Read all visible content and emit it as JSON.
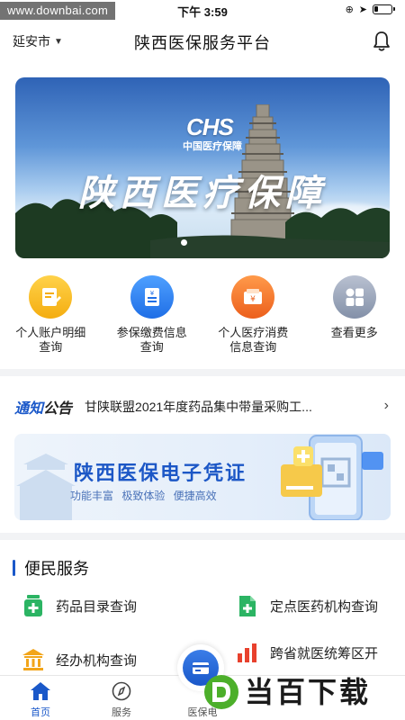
{
  "watermark_top": "www.downbai.com",
  "status_bar": {
    "time": "下午 3:59"
  },
  "header": {
    "city": "延安市",
    "title": "陕西医保服务平台"
  },
  "banner": {
    "logo_text": "CHS",
    "logo_sub": "中国医疗保障",
    "title": "陕西医疗保障"
  },
  "quick_services": [
    {
      "label": "个人账户明细查询",
      "icon": "ledger-icon",
      "color": "#f6b91c"
    },
    {
      "label": "参保缴费信息查询",
      "icon": "document-icon",
      "color": "#2f7df0"
    },
    {
      "label": "个人医疗消费信息查询",
      "icon": "wallet-icon",
      "color": "#f27a2d"
    },
    {
      "label": "查看更多",
      "icon": "grid-icon",
      "color": "#8e98ad"
    }
  ],
  "notice": {
    "tag_blue": "通知",
    "tag_dark": "公告",
    "text": "甘陕联盟2021年度药品集中带量采购工..."
  },
  "ecard": {
    "title": "陕西医保电子凭证",
    "subtitle": "功能丰富  极致体验  便捷高效"
  },
  "convenience": {
    "title": "便民服务",
    "items": [
      {
        "label": "药品目录查询",
        "icon": "medicine-bottle-icon"
      },
      {
        "label": "定点医药机构查询",
        "icon": "medical-doc-icon"
      },
      {
        "label": "经办机构查询",
        "icon": "institution-icon"
      },
      {
        "label": "跨省就医统筹区开",
        "icon": "bar-chart-icon"
      }
    ]
  },
  "tabbar": {
    "home": "首页",
    "service": "服务",
    "ecard": "医保电"
  },
  "watermark_bottom": "当百下载",
  "colors": {
    "primary": "#1a58c9"
  }
}
